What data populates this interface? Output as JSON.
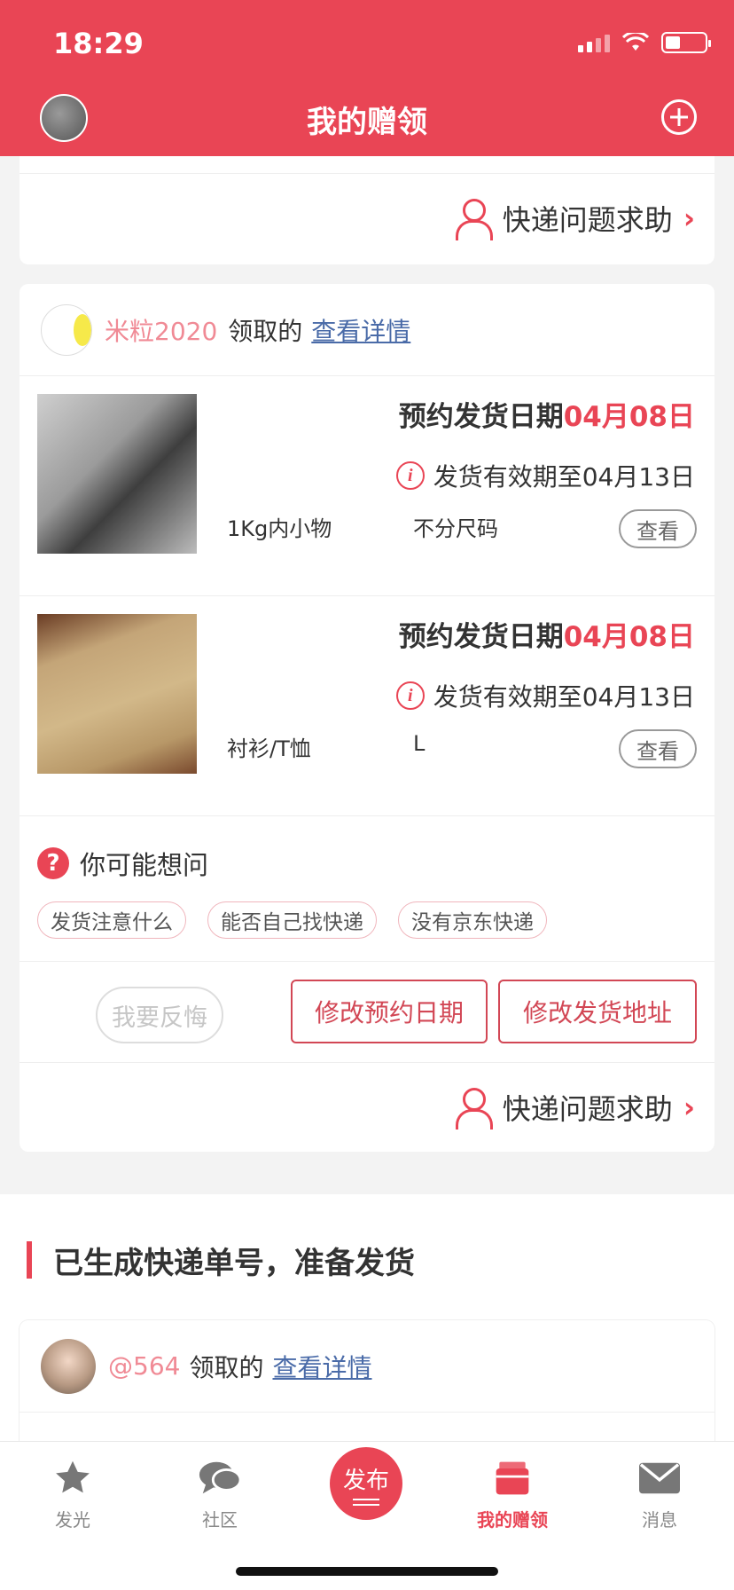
{
  "status": {
    "time": "18:29"
  },
  "header": {
    "title": "我的赠领"
  },
  "top_card": {
    "help_label": "快递问题求助"
  },
  "claim": {
    "claimer": "米粒2020",
    "claimed_text": "领取的",
    "detail_link": "查看详情",
    "items": [
      {
        "date_label": "预约发货日期",
        "date_value": "04月08日",
        "valid_text": "发货有效期至04月13日",
        "category": "1Kg内小物",
        "size": "不分尺码",
        "view_label": "查看"
      },
      {
        "date_label": "预约发货日期",
        "date_value": "04月08日",
        "valid_text": "发货有效期至04月13日",
        "category": "衬衫/T恤",
        "size": "L",
        "view_label": "查看"
      }
    ],
    "faq": {
      "title": "你可能想问",
      "tags": [
        "发货注意什么",
        "能否自己找快递",
        "没有京东快递"
      ]
    },
    "actions": {
      "regret": "我要反悔",
      "change_date": "修改预约日期",
      "change_address": "修改发货地址"
    },
    "help_label": "快递问题求助"
  },
  "section": {
    "title": "已生成快递单号，准备发货",
    "claimer": "@564",
    "claimed_text": "领取的",
    "detail_link": "查看详情"
  },
  "tabbar": {
    "items": [
      {
        "label": "发光",
        "icon": "star-icon"
      },
      {
        "label": "社区",
        "icon": "chat-icon"
      },
      {
        "label": "发布",
        "icon": "publish-icon"
      },
      {
        "label": "我的赠领",
        "icon": "gift-box-icon"
      },
      {
        "label": "消息",
        "icon": "mail-icon"
      }
    ],
    "active": "我的赠领"
  },
  "colors": {
    "accent": "#e94555",
    "link": "#4a6ba8"
  }
}
